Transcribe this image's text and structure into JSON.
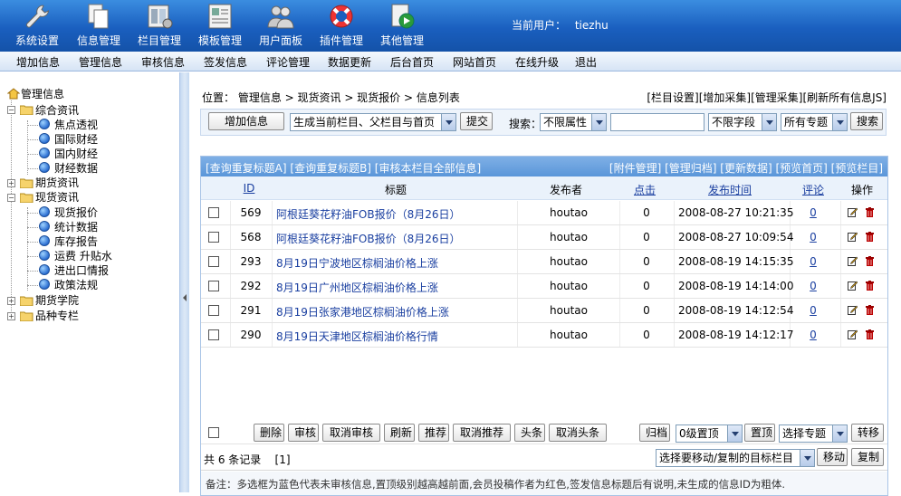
{
  "topbar": {
    "buttons": [
      {
        "label": "系统设置",
        "icon": "wrench-icon"
      },
      {
        "label": "信息管理",
        "icon": "documents-icon"
      },
      {
        "label": "栏目管理",
        "icon": "columns-icon"
      },
      {
        "label": "模板管理",
        "icon": "template-icon"
      },
      {
        "label": "用户面板",
        "icon": "users-icon"
      },
      {
        "label": "插件管理",
        "icon": "lifebuoy-icon"
      },
      {
        "label": "其他管理",
        "icon": "other-manage-icon"
      }
    ],
    "current_user_label": "当前用户：",
    "current_user": "tiezhu"
  },
  "menubar": {
    "items": [
      "增加信息",
      "管理信息",
      "审核信息",
      "签发信息",
      "评论管理",
      "数据更新",
      "后台首页",
      "网站首页",
      "在线升级",
      "退出"
    ]
  },
  "tree": {
    "root": "管理信息",
    "nodes": [
      {
        "label": "综合资讯",
        "type": "folder",
        "expanded": true
      },
      {
        "label": "焦点透视",
        "type": "leaf"
      },
      {
        "label": "国际财经",
        "type": "leaf"
      },
      {
        "label": "国内财经",
        "type": "leaf"
      },
      {
        "label": "财经数据",
        "type": "leaf"
      },
      {
        "label": "期货资讯",
        "type": "folder",
        "expanded": false
      },
      {
        "label": "现货资讯",
        "type": "folder",
        "expanded": true
      },
      {
        "label": "现货报价",
        "type": "leaf"
      },
      {
        "label": "统计数据",
        "type": "leaf"
      },
      {
        "label": "库存报告",
        "type": "leaf"
      },
      {
        "label": "运费 升贴水",
        "type": "leaf"
      },
      {
        "label": "进出口情报",
        "type": "leaf"
      },
      {
        "label": "政策法规",
        "type": "leaf"
      },
      {
        "label": "期货学院",
        "type": "folder",
        "expanded": false
      },
      {
        "label": "品种专栏",
        "type": "folder",
        "expanded": false
      }
    ]
  },
  "breadcrumb": "位置：  管理信息  > 现货资讯  > 现货报价  > 信息列表",
  "right_links": [
    "[栏目设置]",
    "[增加采集]",
    "[管理采集]",
    "[刷新所有信息JS]"
  ],
  "filter": {
    "add_button": "增加信息",
    "generate_select": "生成当前栏目、父栏目与首页",
    "submit": "提交",
    "search_label": "搜索：",
    "attr_select": "不限属性",
    "keyword_value": "",
    "field_select": "不限字段",
    "topic_select": "所有专题",
    "search_button": "搜索"
  },
  "table": {
    "top_left_links": "[查询重复标题A] [查询重复标题B] [审核本栏目全部信息]",
    "top_right_links": "[附件管理] [管理归档] [更新数据] [预览首页] [预览栏目]",
    "columns": {
      "id": "ID",
      "title": "标题",
      "publisher": "发布者",
      "clicks": "点击",
      "time": "发布时间",
      "comments": "评论",
      "ops": "操作"
    },
    "rows": [
      {
        "id": "569",
        "title": "阿根廷葵花籽油FOB报价（8月26日）",
        "publisher": "houtao",
        "clicks": "0",
        "time": "2008-08-27 10:21:35",
        "comments": "0"
      },
      {
        "id": "568",
        "title": "阿根廷葵花籽油FOB报价（8月26日）",
        "publisher": "houtao",
        "clicks": "0",
        "time": "2008-08-27 10:09:54",
        "comments": "0"
      },
      {
        "id": "293",
        "title": "8月19日宁波地区棕榈油价格上涨",
        "publisher": "houtao",
        "clicks": "0",
        "time": "2008-08-19 14:15:35",
        "comments": "0"
      },
      {
        "id": "292",
        "title": "8月19日广州地区棕榈油价格上涨",
        "publisher": "houtao",
        "clicks": "0",
        "time": "2008-08-19 14:14:00",
        "comments": "0"
      },
      {
        "id": "291",
        "title": "8月19日张家港地区棕榈油价格上涨",
        "publisher": "houtao",
        "clicks": "0",
        "time": "2008-08-19 14:12:54",
        "comments": "0"
      },
      {
        "id": "290",
        "title": "8月19日天津地区棕榈油价格行情",
        "publisher": "houtao",
        "clicks": "0",
        "time": "2008-08-19 14:12:17",
        "comments": "0"
      }
    ],
    "actions": {
      "delete": "删除",
      "audit": "审核",
      "cancel_audit": "取消审核",
      "refresh": "刷新",
      "recommend": "推荐",
      "cancel_recommend": "取消推荐",
      "headline": "头条",
      "cancel_headline": "取消头条",
      "archive": "归档",
      "top_level_select": "0级置顶",
      "set_top": "置顶",
      "topic_select": "选择专题",
      "transfer": "转移"
    },
    "page_info": "共 6 条记录    [1]",
    "move_select": "选择要移动/复制的目标栏目",
    "move_button": "移动",
    "copy_button": "复制",
    "note": "备注：多选框为蓝色代表未审核信息,置顶级别越高越前面,会员投稿作者为红色,签发信息标题后有说明,未生成的信息ID为粗体."
  },
  "colors": {
    "topbar": "#1a5fbf",
    "link_blue": "#1a3fa0",
    "header_blue": "#5a96d9"
  }
}
